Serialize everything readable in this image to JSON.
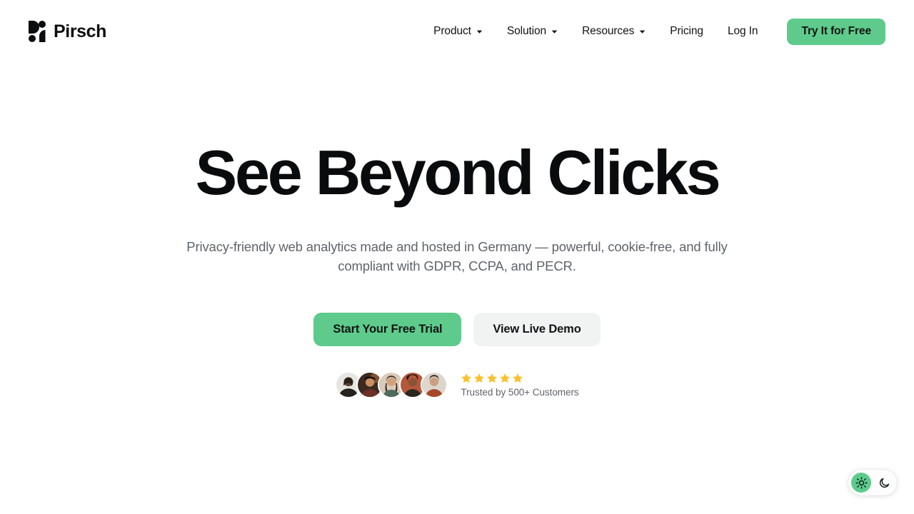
{
  "brand": {
    "name": "Pirsch",
    "logo_icon": "pirsch-logo-mark"
  },
  "nav": {
    "items": [
      {
        "label": "Product",
        "has_dropdown": true,
        "icon": "chevron-down-icon"
      },
      {
        "label": "Solution",
        "has_dropdown": true,
        "icon": "chevron-down-icon"
      },
      {
        "label": "Resources",
        "has_dropdown": true,
        "icon": "chevron-down-icon"
      },
      {
        "label": "Pricing",
        "has_dropdown": false,
        "icon": ""
      },
      {
        "label": "Log In",
        "has_dropdown": false,
        "icon": ""
      }
    ],
    "cta_label": "Try It for Free"
  },
  "hero": {
    "title": "See Beyond Clicks",
    "subtitle": "Privacy-friendly web analytics made and hosted in Germany — powerful, cookie-free, and fully compliant with GDPR, CCPA, and PECR.",
    "primary_cta": "Start Your Free Trial",
    "secondary_cta": "View Live Demo"
  },
  "social_proof": {
    "avatar_count": 5,
    "avatars": [
      "customer-avatar-1",
      "customer-avatar-2",
      "customer-avatar-3",
      "customer-avatar-4",
      "customer-avatar-5"
    ],
    "rating_stars": 5,
    "star_icon": "star-filled-icon",
    "label": "Trusted by 500+ Customers"
  },
  "theme_toggle": {
    "options": [
      {
        "name": "light",
        "icon": "sun-icon",
        "active": true
      },
      {
        "name": "dark",
        "icon": "moon-icon",
        "active": false
      }
    ]
  },
  "colors": {
    "accent_green": "#5ecb8c",
    "star_gold": "#fbc02d",
    "text_primary": "#111316",
    "text_muted": "#5f646b",
    "secondary_button_bg": "#f1f2f2",
    "page_bg": "#ffffff"
  }
}
